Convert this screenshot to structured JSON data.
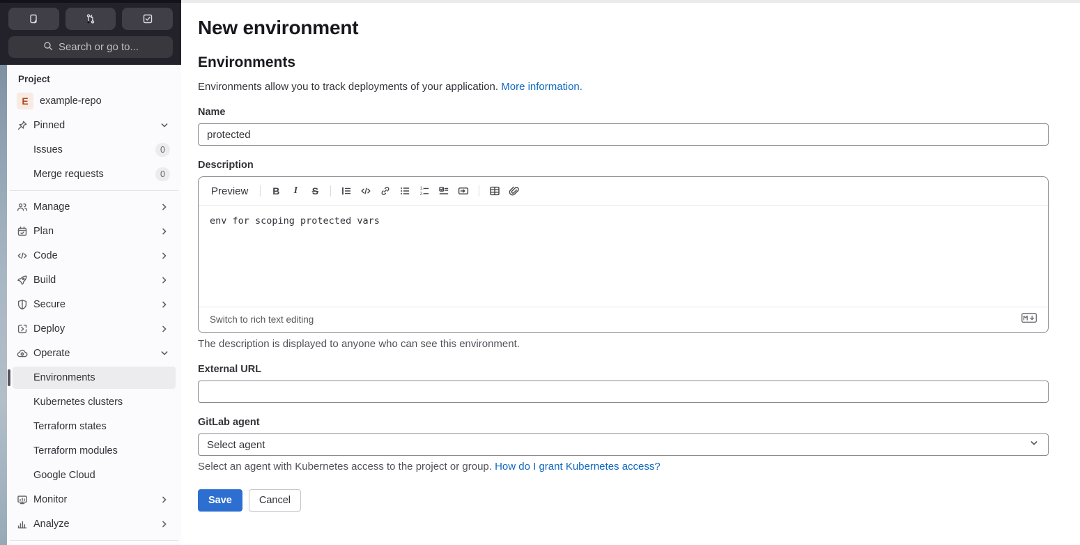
{
  "colors": {
    "link_blue": "#1068bf",
    "save_button": "#2c6fd1",
    "avatar_bg": "#faeae4",
    "avatar_text": "#aa4a1e"
  },
  "topbar": {
    "buttons": [
      {
        "name": "issues-shortcut",
        "icon": "issues-icon"
      },
      {
        "name": "merge-requests-shortcut",
        "icon": "merge-request-icon"
      },
      {
        "name": "todos-shortcut",
        "icon": "todo-icon"
      }
    ],
    "search_placeholder": "Search or go to..."
  },
  "sidebar": {
    "section_label": "Project",
    "project": {
      "avatar_letter": "E",
      "name": "example-repo"
    },
    "items": [
      {
        "label": "Pinned",
        "icon": "pin-icon",
        "chevron": "down"
      },
      {
        "label": "Issues",
        "indent": true,
        "badge": "0"
      },
      {
        "label": "Merge requests",
        "indent": true,
        "badge": "0",
        "divider_after": true
      },
      {
        "label": "Manage",
        "icon": "users-icon",
        "chevron": "right"
      },
      {
        "label": "Plan",
        "icon": "calendar-icon",
        "chevron": "right"
      },
      {
        "label": "Code",
        "icon": "code-icon",
        "chevron": "right"
      },
      {
        "label": "Build",
        "icon": "rocket-icon",
        "chevron": "right"
      },
      {
        "label": "Secure",
        "icon": "shield-icon",
        "chevron": "right"
      },
      {
        "label": "Deploy",
        "icon": "deploy-icon",
        "chevron": "right"
      },
      {
        "label": "Operate",
        "icon": "operate-icon",
        "chevron": "down"
      },
      {
        "label": "Environments",
        "indent": true,
        "active": true
      },
      {
        "label": "Kubernetes clusters",
        "indent": true
      },
      {
        "label": "Terraform states",
        "indent": true
      },
      {
        "label": "Terraform modules",
        "indent": true
      },
      {
        "label": "Google Cloud",
        "indent": true
      },
      {
        "label": "Monitor",
        "icon": "monitor-icon",
        "chevron": "right"
      },
      {
        "label": "Analyze",
        "icon": "chart-icon",
        "chevron": "right",
        "divider_after": true
      }
    ]
  },
  "main": {
    "page_title": "New environment",
    "section_title": "Environments",
    "intro_text": "Environments allow you to track deployments of your application.",
    "intro_link": "More information.",
    "name_field": {
      "label": "Name",
      "value": "protected"
    },
    "description_field": {
      "label": "Description",
      "toolbar": {
        "preview_label": "Preview",
        "icon_groups": [
          [
            "bold-icon",
            "italic-icon",
            "strikethrough-icon"
          ],
          [
            "quote-icon",
            "code-icon",
            "link-icon",
            "bullet-list-icon",
            "numbered-list-icon",
            "task-list-icon",
            "collapsible-section-icon"
          ],
          [
            "table-icon",
            "attach-file-icon"
          ]
        ]
      },
      "value": "env for scoping protected vars",
      "footer_link": "Switch to rich text editing",
      "markdown_icon": "markdown-icon",
      "helper": "The description is displayed to anyone who can see this environment."
    },
    "external_url_field": {
      "label": "External URL",
      "value": ""
    },
    "agent_field": {
      "label": "GitLab agent",
      "selected": "Select agent",
      "helper": "Select an agent with Kubernetes access to the project or group.",
      "helper_link": "How do I grant Kubernetes access?"
    },
    "actions": {
      "save": "Save",
      "cancel": "Cancel"
    }
  }
}
